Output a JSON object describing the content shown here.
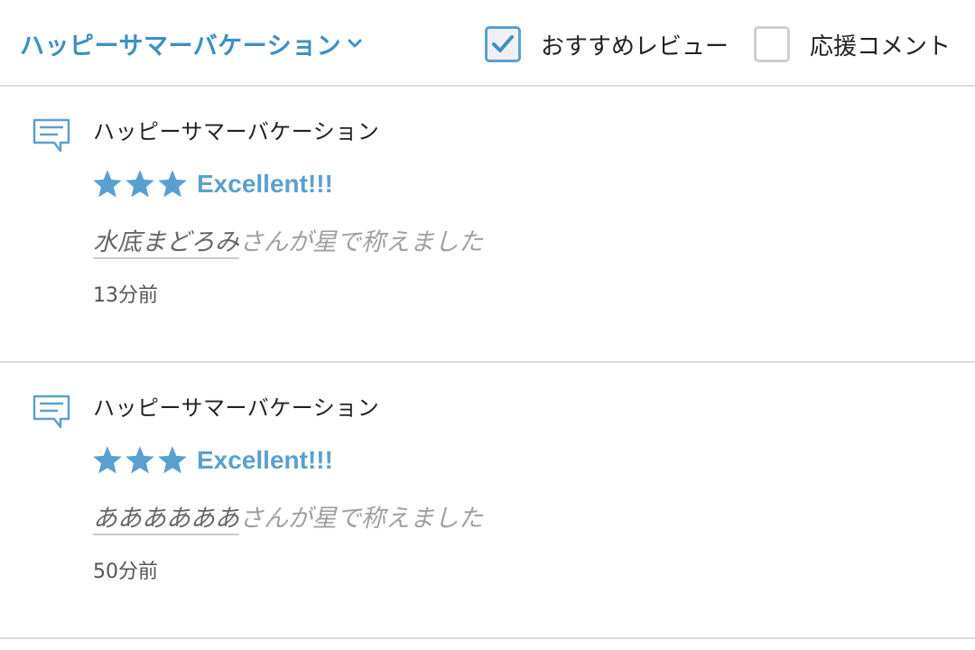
{
  "header": {
    "dropdown_label": "ハッピーサマーバケーション",
    "filters": [
      {
        "label": "おすすめレビュー",
        "checked": true
      },
      {
        "label": "応援コメント",
        "checked": false
      }
    ]
  },
  "items": [
    {
      "title": "ハッピーサマーバケーション",
      "stars": 3,
      "rating_label": "Excellent!!!",
      "user": "水底まどろみ",
      "praise_text": "さんが星で称えました",
      "time": "13分前"
    },
    {
      "title": "ハッピーサマーバケーション",
      "stars": 3,
      "rating_label": "Excellent!!!",
      "user": "ああああああ",
      "praise_text": "さんが星で称えました",
      "time": "50分前"
    }
  ],
  "colors": {
    "accent": "#3d8fc4",
    "star": "#5aa0cf",
    "divider": "#dcdcdc",
    "muted_text": "#a0a0a0"
  },
  "icons": {
    "dropdown": "chevron-down-icon",
    "checkbox_checked": "checkmark-icon",
    "item": "comment-icon",
    "rating": "star-icon"
  }
}
